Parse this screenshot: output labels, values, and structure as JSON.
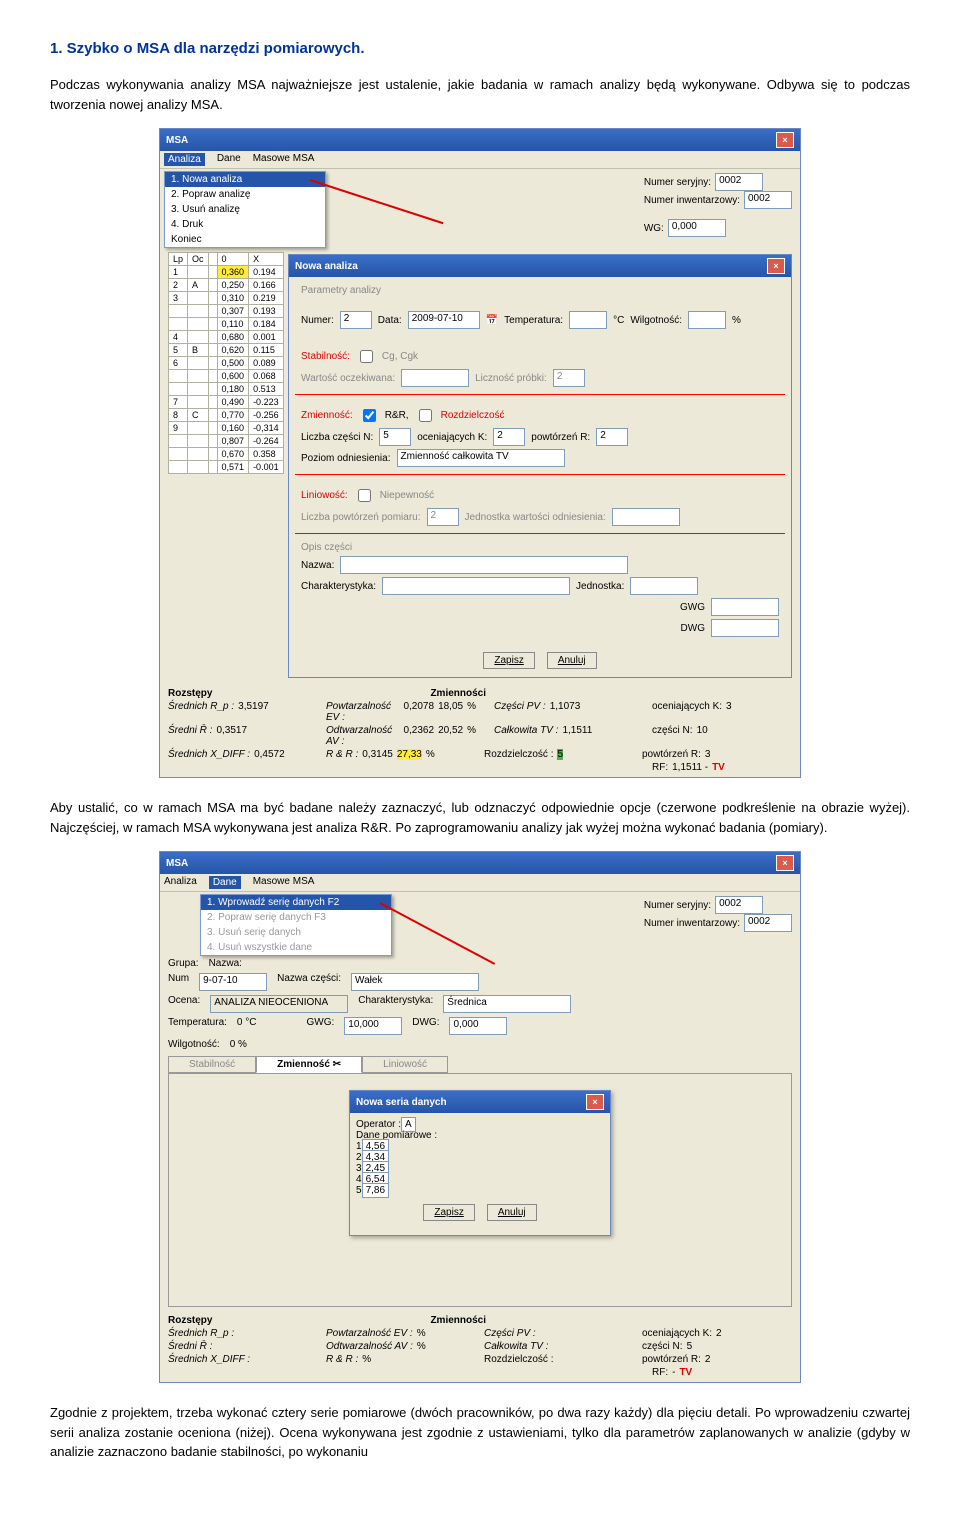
{
  "heading": "1. Szybko o MSA dla narzędzi pomiarowych.",
  "para1": "Podczas wykonywania analizy MSA najważniejsze jest ustalenie, jakie badania w ramach analizy będą wykonywane. Odbywa się to podczas tworzenia nowej analizy MSA.",
  "para2": "Aby ustalić, co w ramach MSA ma być badane należy zaznaczyć, lub odznaczyć odpowiednie opcje (czerwone podkreślenie na obrazie wyżej). Najczęściej, w ramach MSA wykonywana jest analiza R&R. Po zaprogramowaniu analizy jak wyżej można wykonać badania (pomiary).",
  "para3": "Zgodnie z projektem, trzeba wykonać cztery serie pomiarowe (dwóch pracowników, po dwa razy każdy) dla pięciu detali. Po wprowadzeniu czwartej serii analiza zostanie oceniona (niżej). Ocena wykonywana jest zgodnie z ustawieniami, tylko dla parametrów zaplanowanych w analizie (gdyby w analizie zaznaczono badanie stabilności, po wykonaniu",
  "win1": {
    "title": "MSA",
    "menu": {
      "m1": "Analiza",
      "m2": "Dane",
      "m3": "Masowe MSA"
    },
    "drop": {
      "i1": "1. Nowa analiza",
      "i2": "2. Popraw analizę",
      "i3": "3. Usuń analizę",
      "i4": "4. Druk",
      "i5": "Koniec"
    },
    "rightTop": {
      "l1": "Numer seryjny:",
      "v1": "0002",
      "l2": "Numer inwentarzowy:",
      "v2": "0002",
      "l3": "WG:",
      "v3": "0,000"
    },
    "dlg": {
      "title": "Nowa analiza",
      "section1": "Parametry analizy",
      "numer_l": "Numer:",
      "numer_v": "2",
      "data_l": "Data:",
      "data_v": "2009-07-10",
      "temp_l": "Temperatura:",
      "temp_u": "°C",
      "wilg_l": "Wilgotność:",
      "wilg_u": "%",
      "stab_l": "Stabilność:",
      "stab_cb": "Cg, Cgk",
      "wart_l": "Wartość oczekiwana:",
      "licz_l": "Liczność próbki:",
      "licz_v": "2",
      "zm_l": "Zmienność:",
      "zm_cb1": "R&R,",
      "zm_cb2": "Rozdzielczość",
      "lcz_l": "Liczba części N:",
      "lcz_v": "5",
      "oc_l": "oceniających K:",
      "oc_v": "2",
      "pw_l": "powtórzeń R:",
      "pw_v": "2",
      "poz_l": "Poziom odniesienia:",
      "poz_v": "Zmienność całkowita TV",
      "lin_l": "Liniowość:",
      "lin_cb": "Niepewność",
      "lp_l": "Liczba powtórzeń pomiaru:",
      "lp_v": "2",
      "jw_l": "Jednostka wartości odniesienia:",
      "op_l": "Opis części",
      "naz_l": "Nazwa:",
      "char_l": "Charakterystyka:",
      "jed_l": "Jednostka:",
      "gwg_l": "GWG",
      "dwg_l": "DWG",
      "zapisz": "Zapisz",
      "anuluj": "Anuluj"
    },
    "table": [
      [
        "Lp",
        "Oc",
        "",
        "0",
        "X"
      ],
      [
        "1",
        "",
        "",
        "0,360",
        "0.194"
      ],
      [
        "2",
        "A",
        "",
        "0,250",
        "0.166"
      ],
      [
        "3",
        "",
        "",
        "0,310",
        "0.219"
      ],
      [
        "",
        "",
        "",
        "0,307",
        "0.193"
      ],
      [
        "",
        "",
        "",
        "0,110",
        "0.184"
      ],
      [
        "4",
        "",
        "",
        "0,680",
        "0.001"
      ],
      [
        "5",
        "B",
        "",
        "0,620",
        "0.115"
      ],
      [
        "6",
        "",
        "",
        "0,500",
        "0.089"
      ],
      [
        "",
        "",
        "",
        "0,600",
        "0.068"
      ],
      [
        "",
        "",
        "",
        "0,180",
        "0.513"
      ],
      [
        "7",
        "",
        "",
        "0,490",
        "-0.223"
      ],
      [
        "8",
        "C",
        "",
        "0,770",
        "-0.256"
      ],
      [
        "9",
        "",
        "",
        "0,160",
        "-0,314"
      ],
      [
        "",
        "",
        "",
        "0,807",
        "-0.264"
      ],
      [
        "",
        "",
        "",
        "0,670",
        "0.358"
      ],
      [
        "",
        "",
        "",
        "0,571",
        "-0.001"
      ]
    ],
    "summary": {
      "roz_l": "Rozstępy",
      "zm_l": "Zmienności",
      "r1a_l": "Średnich R_p :",
      "r1a": "3,5197",
      "r1b_l": "Powtarzalność EV :",
      "r1b": "0,2078",
      "r1c": "18,05",
      "r1c_u": "%",
      "r1d_l": "Części    PV :",
      "r1d": "1,1073",
      "r1e_l": "oceniających K:",
      "r1e": "3",
      "r2a_l": "Średni  R̄  :",
      "r2a": "0,3517",
      "r2b_l": "Odtwarzalność AV :",
      "r2b": "0,2362",
      "r2c": "20,52",
      "r2c_u": "%",
      "r2d_l": "Całkowita TV :",
      "r2d": "1,1511",
      "r2e_l": "części N:",
      "r2e": "10",
      "r3a_l": "Średnich X_DIFF :",
      "r3a": "0,4572",
      "r3b_l": "R & R :",
      "r3b": "0,3145",
      "r3c": "27,33",
      "r3c_u": "%",
      "r3d_l": "Rozdzielczość   :",
      "r3d": "5",
      "r3e_l": "powtórzeń R:",
      "r3e": "3",
      "r4_l": "RF:",
      "r4": "1,1511 -",
      "r4b": "TV"
    }
  },
  "win2": {
    "title": "MSA",
    "menu": {
      "m1": "Analiza",
      "m2": "Dane",
      "m3": "Masowe MSA"
    },
    "drop": {
      "i1": "1. Wprowadź serię danych  F2",
      "i2": "2. Popraw serię danych       F3",
      "i3": "3. Usuń serię danych",
      "i4": "4. Usuń wszystkie dane"
    },
    "top": {
      "grupa_l": "Grupa:",
      "nazwa_l": "Nazwa:",
      "numser_l": "Numer seryjny:",
      "numser_v": "0002",
      "numinw_l": "Numer inwentarzowy:",
      "numinw_v": "0002",
      "num_l": "Num",
      "num_date": "9-07-10",
      "nazcz_l": "Nazwa części:",
      "nazcz_v": "Wałek",
      "ocena_l": "Ocena:",
      "ocena_v": "ANALIZA NIEOCENIONA",
      "char_l": "Charakterystyka:",
      "char_v": "Średnica",
      "temp_l": "Temperatura:",
      "temp_v": "0 °C",
      "gwg_l": "GWG:",
      "gwg_v": "10,000",
      "dwg_l": "DWG:",
      "dwg_v": "0,000",
      "wilg_l": "Wilgotność:",
      "wilg_v": "0 %"
    },
    "tabs": {
      "t1": "Stabilność",
      "t2": "Zmienność",
      "t3": "Liniowość"
    },
    "dlg": {
      "title": "Nowa seria danych",
      "op_l": "Operator :",
      "op_v": "A",
      "dp_l": "Dane pomiarowe :",
      "rows": [
        [
          "1",
          "4,56"
        ],
        [
          "2",
          "4,34"
        ],
        [
          "3",
          "2,45"
        ],
        [
          "4",
          "6,54"
        ],
        [
          "5",
          "7,86"
        ]
      ],
      "zapisz": "Zapisz",
      "anuluj": "Anuluj"
    },
    "summary": {
      "roz_l": "Rozstępy",
      "zm_l": "Zmienności",
      "r1a_l": "Średnich R_p    :",
      "r1b_l": "Powtarzalność EV :",
      "r1c_u": "%",
      "r1d_l": "Części     PV :",
      "r1e_l": "oceniających K:",
      "r1e": "2",
      "r2a_l": "Średni  R̄    :",
      "r2b_l": "Odtwarzalność AV :",
      "r2c_u": "%",
      "r2d_l": "Całkowita TV :",
      "r2e_l": "części N:",
      "r2e": "5",
      "r3a_l": "Średnich X_DIFF :",
      "r3b_l": "R & R :",
      "r3c_u": "%",
      "r3d_l": "Rozdzielczość   :",
      "r3e_l": "powtórzeń R:",
      "r3e": "2",
      "r4_l": "RF:",
      "r4b": "TV"
    }
  }
}
